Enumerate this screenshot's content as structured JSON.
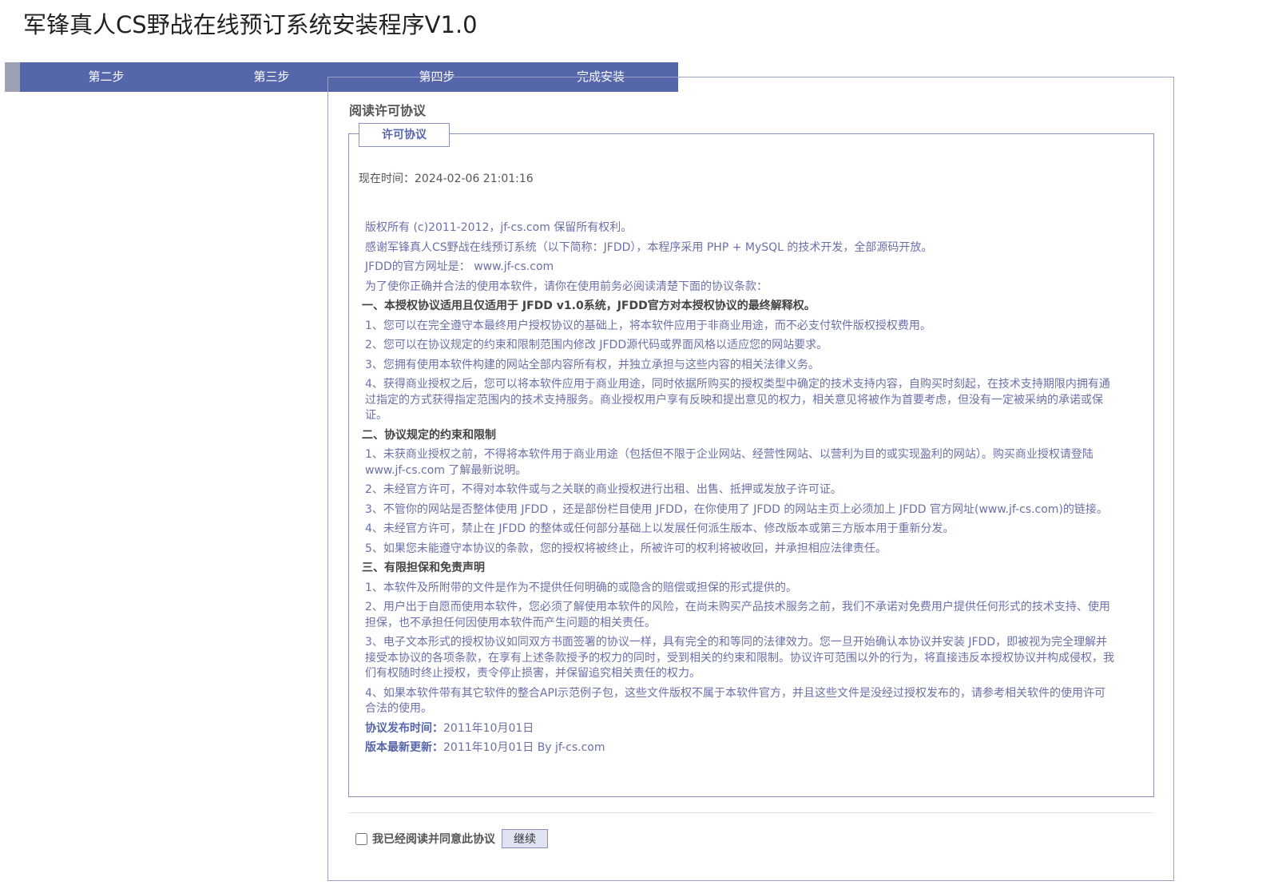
{
  "app": {
    "title": "军锋真人CS野战在线预订系统安装程序V1.0"
  },
  "steps": [
    {
      "label": "第二步"
    },
    {
      "label": "第三步"
    },
    {
      "label": "第四步"
    },
    {
      "label": "完成安装"
    }
  ],
  "section": {
    "title": "阅读许可协议",
    "legend": "许可协议"
  },
  "time": {
    "label": "现在时间：",
    "value": "2024-02-06 21:01:16"
  },
  "agreement": {
    "lines": [
      "版权所有 (c)2011-2012，jf-cs.com 保留所有权利。",
      "感谢军锋真人CS野战在线预订系统（以下简称：JFDD），本程序采用 PHP + MySQL 的技术开发，全部源码开放。",
      "JFDD的官方网址是： www.jf-cs.com",
      "为了使你正确并合法的使用本软件，请你在使用前务必阅读清楚下面的协议条款："
    ],
    "h1": "一、本授权协议适用且仅适用于 JFDD v1.0系统，JFDD官方对本授权协议的最终解释权。",
    "s1": [
      "1、您可以在完全遵守本最终用户授权协议的基础上，将本软件应用于非商业用途，而不必支付软件版权授权费用。",
      "2、您可以在协议规定的约束和限制范围内修改 JFDD源代码或界面风格以适应您的网站要求。",
      "3、您拥有使用本软件构建的网站全部内容所有权，并独立承担与这些内容的相关法律义务。",
      "4、获得商业授权之后，您可以将本软件应用于商业用途，同时依据所购买的授权类型中确定的技术支持内容，自购买时刻起，在技术支持期限内拥有通过指定的方式获得指定范围内的技术支持服务。商业授权用户享有反映和提出意见的权力，相关意见将被作为首要考虑，但没有一定被采纳的承诺或保证。"
    ],
    "h2": "二、协议规定的约束和限制",
    "s2": [
      "1、未获商业授权之前，不得将本软件用于商业用途（包括但不限于企业网站、经营性网站、以营利为目的或实现盈利的网站）。购买商业授权请登陆 www.jf-cs.com 了解最新说明。",
      "2、未经官方许可，不得对本软件或与之关联的商业授权进行出租、出售、抵押或发放子许可证。",
      "3、不管你的网站是否整体使用 JFDD ，还是部份栏目使用 JFDD，在你使用了 JFDD 的网站主页上必须加上 JFDD 官方网址(www.jf-cs.com)的链接。",
      "4、未经官方许可，禁止在 JFDD 的整体或任何部分基础上以发展任何派生版本、修改版本或第三方版本用于重新分发。",
      "5、如果您未能遵守本协议的条款，您的授权将被终止，所被许可的权利将被收回，并承担相应法律责任。"
    ],
    "h3": "三、有限担保和免责声明",
    "s3": [
      "1、本软件及所附带的文件是作为不提供任何明确的或隐含的赔偿或担保的形式提供的。",
      "2、用户出于自愿而使用本软件，您必须了解使用本软件的风险，在尚未购买产品技术服务之前，我们不承诺对免费用户提供任何形式的技术支持、使用担保，也不承担任何因使用本软件而产生问题的相关责任。",
      "3、电子文本形式的授权协议如同双方书面签署的协议一样，具有完全的和等同的法律效力。您一旦开始确认本协议并安装 JFDD，即被视为完全理解并接受本协议的各项条款，在享有上述条款授予的权力的同时，受到相关的约束和限制。协议许可范围以外的行为，将直接违反本授权协议并构成侵权，我们有权随时终止授权，责令停止损害，并保留追究相关责任的权力。",
      "4、如果本软件带有其它软件的整合API示范例子包，这些文件版权不属于本软件官方，并且这些文件是没经过授权发布的，请参考相关软件的使用许可合法的使用。"
    ],
    "release_label": "协议发布时间：",
    "release_value": "2011年10月01日",
    "update_label": "版本最新更新：",
    "update_value": "2011年10月01日 By jf-cs.com"
  },
  "agree": {
    "label": "我已经阅读并同意此协议",
    "checked": false
  },
  "continue_button": "继续"
}
